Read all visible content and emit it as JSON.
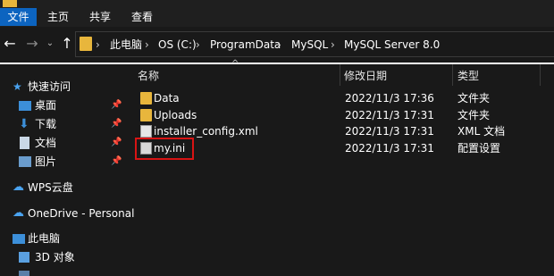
{
  "ribbon": {
    "tabs": [
      {
        "label": "文件"
      },
      {
        "label": "主页"
      },
      {
        "label": "共享"
      },
      {
        "label": "查看"
      }
    ]
  },
  "nav": {
    "back_icon": "arrow-left-icon",
    "forward_icon": "arrow-right-icon",
    "dropdown_icon": "chevron-down-icon",
    "up_icon": "arrow-up-icon"
  },
  "address": {
    "crumbs": [
      "此电脑",
      "OS (C:)",
      "ProgramData",
      "MySQL",
      "MySQL Server 8.0"
    ]
  },
  "sidebar": {
    "items": [
      {
        "label": "快速访问",
        "icon": "star-icon"
      },
      {
        "label": "桌面",
        "icon": "desktop-icon"
      },
      {
        "label": "下载",
        "icon": "download-icon"
      },
      {
        "label": "文档",
        "icon": "document-icon"
      },
      {
        "label": "图片",
        "icon": "pictures-icon"
      },
      {
        "label": "WPS云盘",
        "icon": "cloud-icon"
      },
      {
        "label": "OneDrive - Personal",
        "icon": "onedrive-icon"
      },
      {
        "label": "此电脑",
        "icon": "computer-icon"
      },
      {
        "label": "3D 对象",
        "icon": "cube-icon"
      }
    ]
  },
  "columns": {
    "name": "名称",
    "modified": "修改日期",
    "type": "类型"
  },
  "files": [
    {
      "name": "Data",
      "date": "2022/11/3 17:36",
      "type": "文件夹",
      "icon": "folder-icon"
    },
    {
      "name": "Uploads",
      "date": "2022/11/3 17:31",
      "type": "文件夹",
      "icon": "folder-icon"
    },
    {
      "name": "installer_config.xml",
      "date": "2022/11/3 17:31",
      "type": "XML 文档",
      "icon": "xml-file-icon"
    },
    {
      "name": "my.ini",
      "date": "2022/11/3 17:31",
      "type": "配置设置",
      "icon": "ini-file-icon"
    }
  ],
  "colors": {
    "accent": "#0c64c0",
    "folder": "#e8b63c",
    "highlight": "#d81414"
  }
}
